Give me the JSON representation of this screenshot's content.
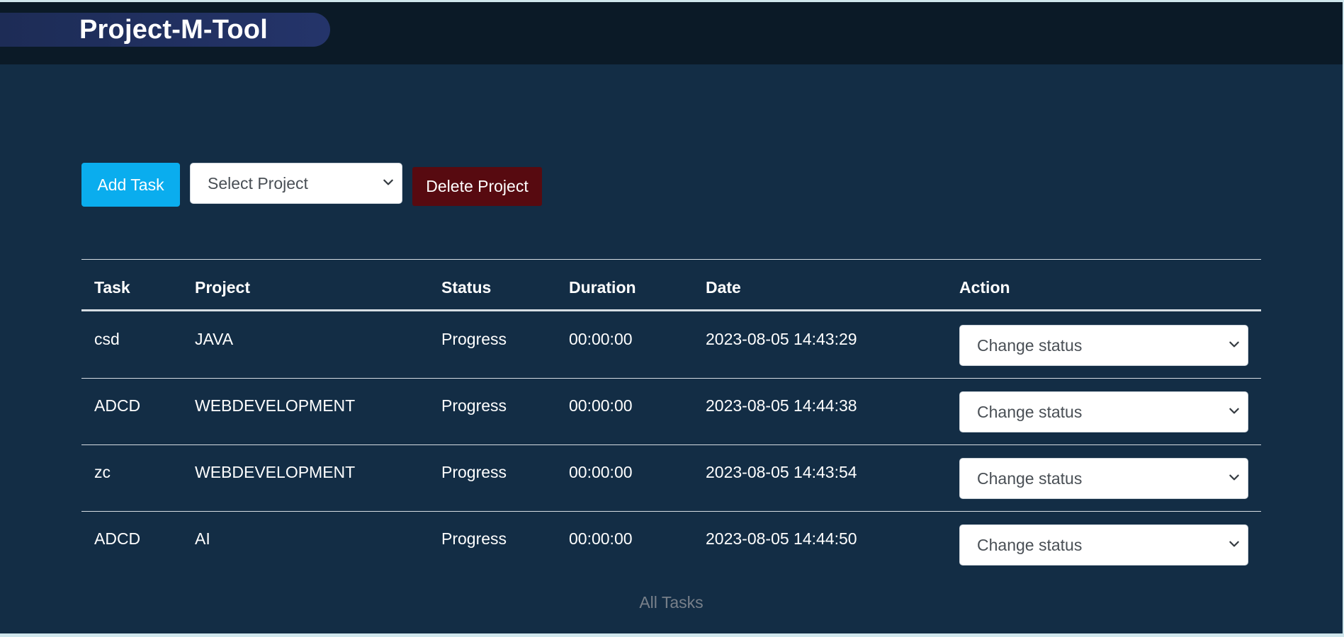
{
  "app": {
    "title": "Project-M-Tool"
  },
  "toolbar": {
    "add_task_label": "Add Task",
    "project_select_value": "Select Project",
    "delete_project_label": "Delete Project"
  },
  "table": {
    "columns": [
      "Task",
      "Project",
      "Status",
      "Duration",
      "Date",
      "Action"
    ],
    "rows": [
      {
        "task": "csd",
        "project": "JAVA",
        "status": "Progress",
        "duration": "00:00:00",
        "date": "2023-08-05 14:43:29",
        "action": "Change status"
      },
      {
        "task": "ADCD",
        "project": "WEBDEVELOPMENT",
        "status": "Progress",
        "duration": "00:00:00",
        "date": "2023-08-05 14:44:38",
        "action": "Change status"
      },
      {
        "task": "zc",
        "project": "WEBDEVELOPMENT",
        "status": "Progress",
        "duration": "00:00:00",
        "date": "2023-08-05 14:43:54",
        "action": "Change status"
      },
      {
        "task": "ADCD",
        "project": "AI",
        "status": "Progress",
        "duration": "00:00:00",
        "date": "2023-08-05 14:44:50",
        "action": "Change status"
      }
    ],
    "caption": "All Tasks"
  },
  "icons": {
    "select_chevron": "chevron-down-icon"
  },
  "colors": {
    "page_bg": "#132d45",
    "topbar_bg": "#0b1a27",
    "brand_pill": "#24346a",
    "add_button": "#0aadee",
    "delete_button": "#570a10",
    "caption_text": "#78808a"
  }
}
